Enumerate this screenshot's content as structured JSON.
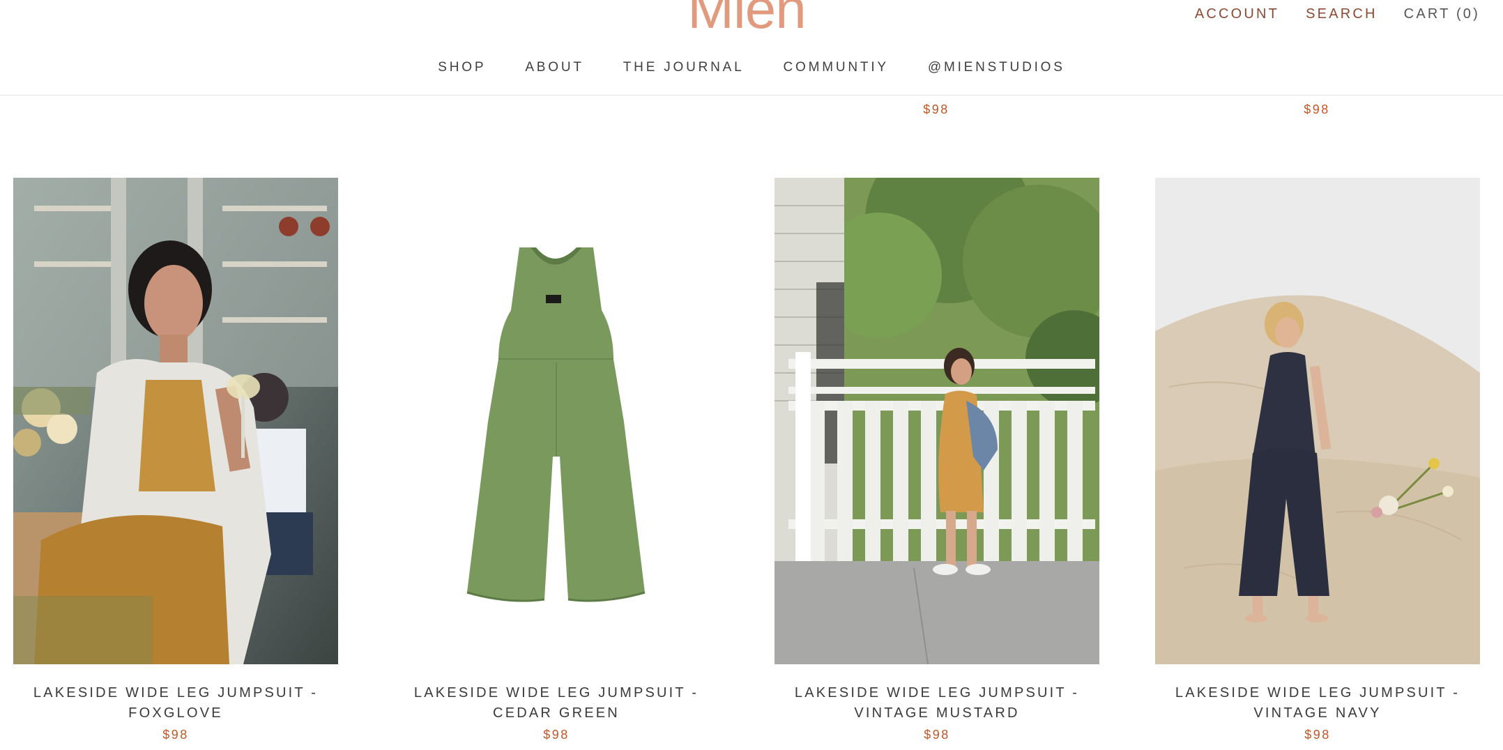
{
  "brand": {
    "logo_text": "Mien",
    "logo_color": "#e19a7e",
    "price_color": "#c25727"
  },
  "header": {
    "account_label": "ACCOUNT",
    "search_label": "SEARCH",
    "cart_label": "CART (0)"
  },
  "nav": {
    "items": [
      {
        "label": "SHOP"
      },
      {
        "label": "ABOUT"
      },
      {
        "label": "THE JOURNAL"
      },
      {
        "label": "COMMUNTIY"
      },
      {
        "label": "@MIENSTUDIOS"
      }
    ]
  },
  "previous_row": {
    "prices": [
      "$98",
      "$98"
    ]
  },
  "products": [
    {
      "title": "LAKESIDE WIDE LEG JUMPSUIT - FOXGLOVE",
      "price": "$98",
      "image_desc": "woman-in-mustard-jumpsuit-photo"
    },
    {
      "title": "LAKESIDE WIDE LEG JUMPSUIT - CEDAR GREEN",
      "price": "$98",
      "image_desc": "green-jumpsuit-flatlay-photo"
    },
    {
      "title": "LAKESIDE WIDE LEG JUMPSUIT - VINTAGE MUSTARD",
      "price": "$98",
      "image_desc": "woman-by-white-gate-photo"
    },
    {
      "title": "LAKESIDE WIDE LEG JUMPSUIT - VINTAGE NAVY",
      "price": "$98",
      "image_desc": "woman-on-sand-dune-photo"
    }
  ]
}
